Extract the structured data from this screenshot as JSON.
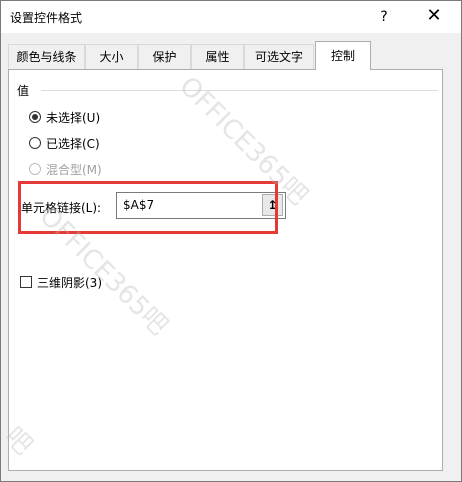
{
  "window": {
    "title": "设置控件格式",
    "help_label": "?",
    "close_label": "✕"
  },
  "tabs": [
    {
      "label": "颜色与线条",
      "active": false
    },
    {
      "label": "大小",
      "active": false
    },
    {
      "label": "保护",
      "active": false
    },
    {
      "label": "属性",
      "active": false
    },
    {
      "label": "可选文字",
      "active": false
    },
    {
      "label": "控制",
      "active": true
    }
  ],
  "value_group": {
    "label": "值",
    "options": [
      {
        "label": "未选择(U)",
        "checked": true,
        "disabled": false
      },
      {
        "label": "已选择(C)",
        "checked": false,
        "disabled": false
      },
      {
        "label": "混合型(M)",
        "checked": false,
        "disabled": true
      }
    ]
  },
  "cell_link": {
    "label": "单元格链接(L):",
    "value": "$A$7",
    "ref_icon": "↥"
  },
  "shading": {
    "label": "三维阴影(3)",
    "checked": false
  },
  "highlight_color": "#e53935",
  "watermark": {
    "text_1": "OFFICE365吧",
    "text_2": "OFFICE365吧",
    "text_3": "吧"
  }
}
